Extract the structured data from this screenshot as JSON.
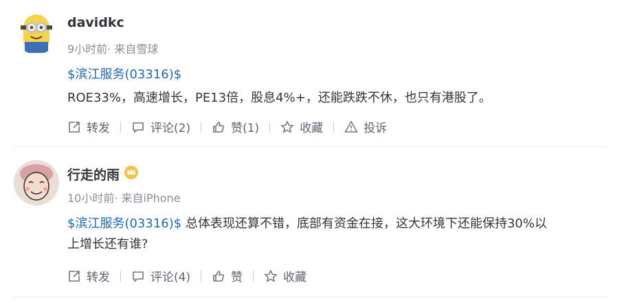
{
  "posts": [
    {
      "username": "davidkc",
      "meta": "9小时前· 来自雪球",
      "stock_link": "$滨江服务(03316)$",
      "text": "ROE33%，高速增长，PE13倍，股息4%+，还能跌跌不休，也只有港股了。",
      "actions": {
        "forward": "转发",
        "comment": "评论(2)",
        "like": "赞(1)",
        "favorite": "收藏",
        "report": "投诉"
      }
    },
    {
      "username": "行走的雨",
      "meta": "10小时前· 来自iPhone",
      "stock_link": "$滨江服务(03316)$",
      "text_line1": " 总体表现还算不错，底部有资金在接，这大环境下还能保持30%以",
      "text_line2": "上增长还有谁?",
      "actions": {
        "forward": "转发",
        "comment": "评论(4)",
        "like": "赞",
        "favorite": "收藏"
      }
    }
  ],
  "colors": {
    "link": "#1f6ab4",
    "text": "#33353c",
    "meta": "#8a8e99",
    "icon": "#5f6370"
  }
}
